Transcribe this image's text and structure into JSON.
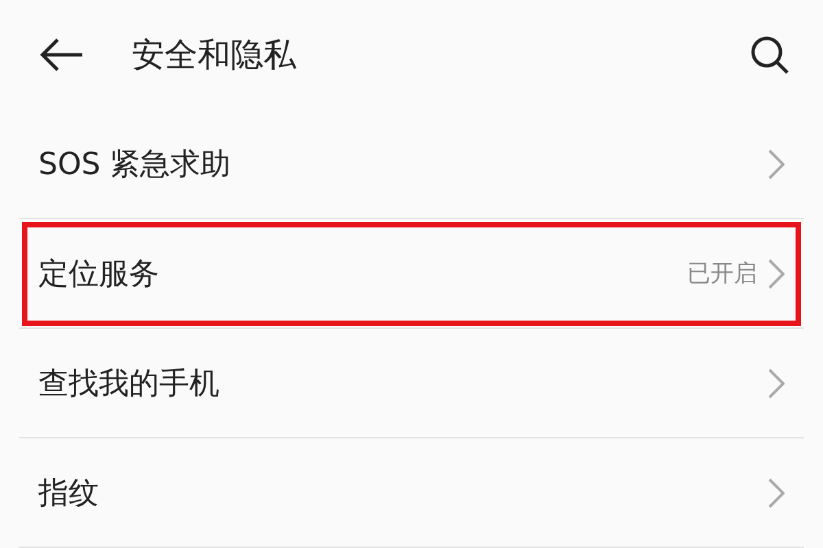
{
  "header": {
    "title": "安全和隐私"
  },
  "items": [
    {
      "label": "SOS 紧急求助",
      "highlighted": false
    },
    {
      "label": "定位服务",
      "value": "已开启",
      "highlighted": true
    },
    {
      "label": "查找我的手机",
      "highlighted": false
    },
    {
      "label": "指纹",
      "highlighted": false
    }
  ]
}
